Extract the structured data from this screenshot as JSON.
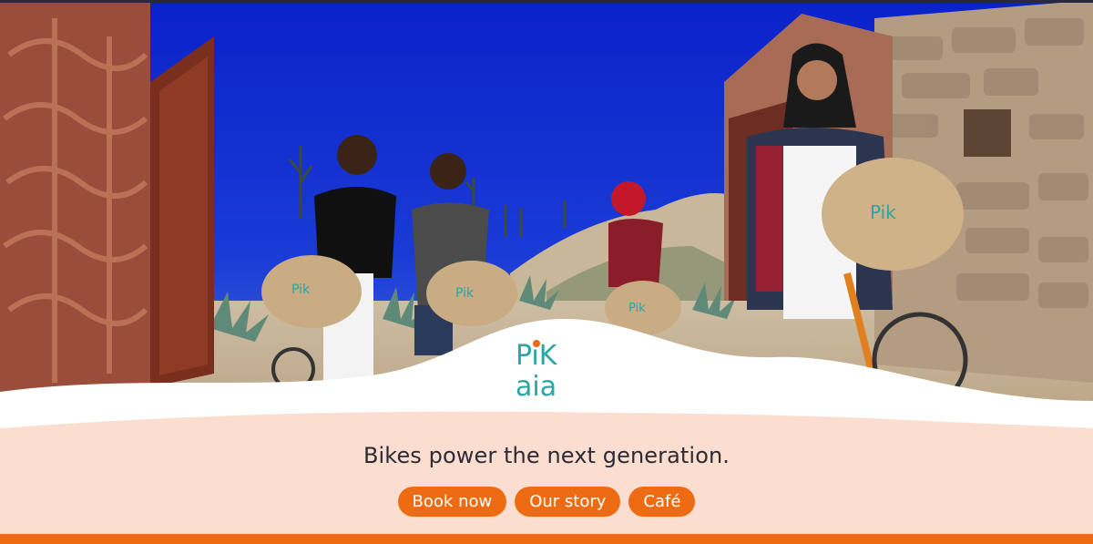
{
  "brand": {
    "logo_line1": "PiK",
    "logo_line2": "aia",
    "accent_color": "#ed6b13",
    "teal_color": "#2aa6a4",
    "background_color": "#fbded0"
  },
  "hero": {
    "image_description_icon": "hero-photo"
  },
  "tagline": "Bikes power the next generation.",
  "buttons": [
    {
      "label": "Book now"
    },
    {
      "label": "Our story"
    },
    {
      "label": "Café"
    }
  ]
}
